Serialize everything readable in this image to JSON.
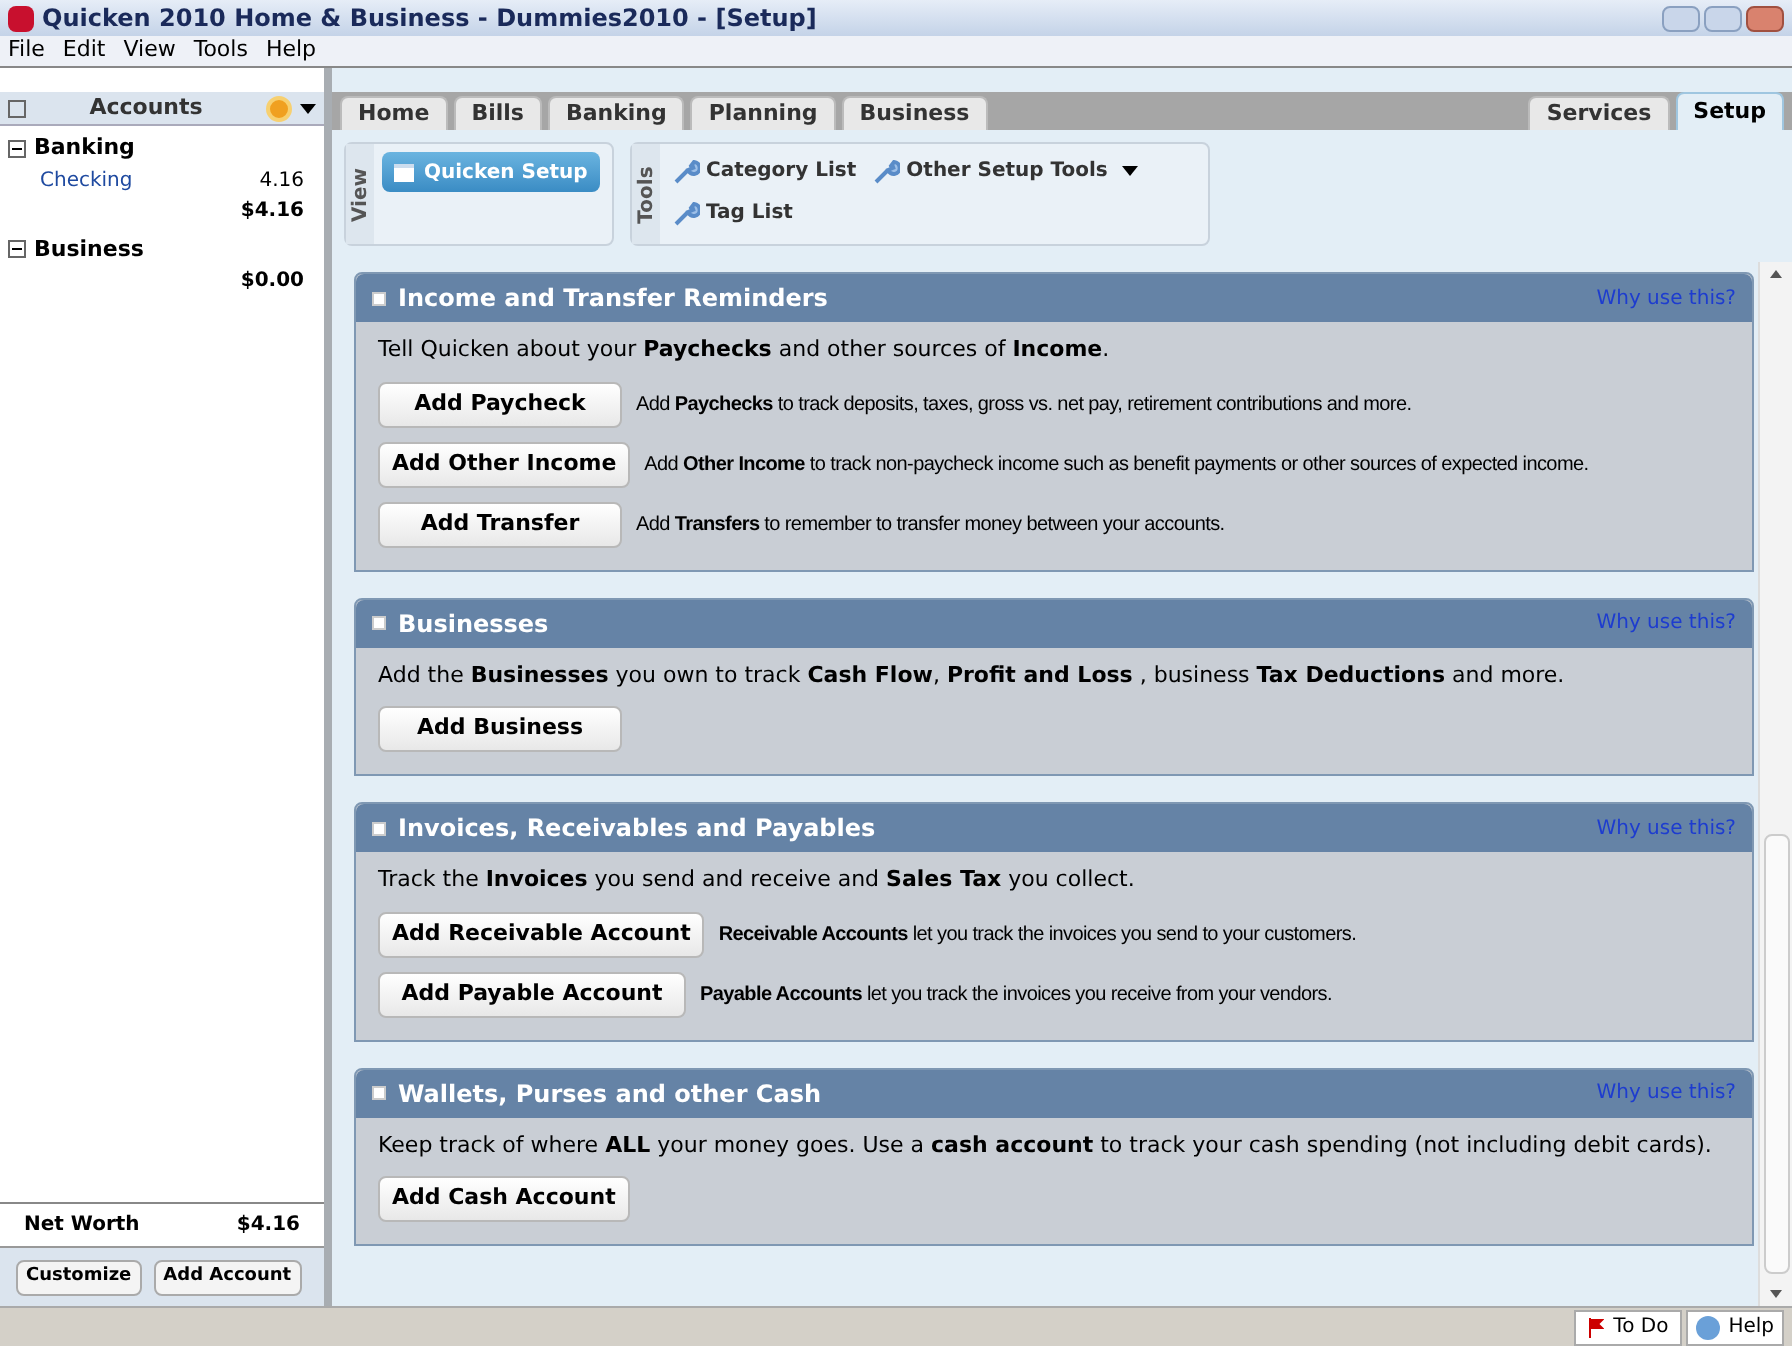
{
  "window": {
    "title": "Quicken 2010 Home & Business - Dummies2010 - [Setup]"
  },
  "menu": [
    "File",
    "Edit",
    "View",
    "Tools",
    "Help"
  ],
  "sidebar": {
    "header": "Accounts",
    "groups": [
      {
        "name": "Banking",
        "expanded": true,
        "items": [
          {
            "name": "Checking",
            "amount": "4.16"
          }
        ],
        "total": "$4.16"
      },
      {
        "name": "Business",
        "expanded": true,
        "total": "$0.00"
      }
    ],
    "net_worth_label": "Net Worth",
    "net_worth": "$4.16",
    "buttons": [
      "Customize",
      "Add Account"
    ]
  },
  "tabs_left": [
    {
      "label": "Home",
      "selected": false
    },
    {
      "label": "Bills",
      "selected": false
    },
    {
      "label": "Banking",
      "selected": false
    },
    {
      "label": "Planning",
      "selected": false
    },
    {
      "label": "Business",
      "selected": false
    }
  ],
  "tabs_right": [
    {
      "label": "Services",
      "selected": false
    },
    {
      "label": "Setup",
      "selected": true
    }
  ],
  "view_panel": {
    "label": "View",
    "button": "Quicken Setup"
  },
  "tools_panel": {
    "label": "Tools",
    "items": [
      {
        "label": "Category List",
        "dropdown": false
      },
      {
        "label": "Other Setup Tools",
        "dropdown": true
      },
      {
        "label": "Tag List",
        "dropdown": false
      }
    ]
  },
  "sections": [
    {
      "title": "Income and Transfer Reminders",
      "link": "Why use this?",
      "intro": "Tell Quicken about your **Paychecks** and other sources of **Income**.",
      "actions": [
        {
          "button": "Add Paycheck",
          "description": "Add **Paychecks** to track deposits, taxes, gross vs. net pay, retirement contributions and more."
        },
        {
          "button": "Add Other Income",
          "description": "Add **Other Income** to track non-paycheck income such as benefit payments or other sources of expected income."
        },
        {
          "button": "Add Transfer",
          "description": "Add **Transfers** to remember to transfer money between your accounts."
        }
      ]
    },
    {
      "title": "Businesses",
      "link": "Why use this?",
      "intro": "Add the **Businesses** you own to track **Cash Flow**, **Profit and Loss** , business **Tax Deductions** and more.",
      "actions": [
        {
          "button": "Add Business"
        }
      ]
    },
    {
      "title": "Invoices, Receivables and Payables",
      "link": "Why use this?",
      "intro": "Track the **Invoices** you send and receive and **Sales Tax** you collect.",
      "actions": [
        {
          "button": "Add Receivable Account",
          "description": "**Receivable Accounts** let you track the invoices you send to your customers."
        },
        {
          "button": "Add Payable Account",
          "description": "**Payable Accounts** let you track the invoices you receive from your vendors."
        }
      ]
    },
    {
      "title": "Wallets, Purses and other Cash",
      "link": "Why use this?",
      "intro": "Keep track of where **ALL** your money goes. Use a **cash account** to track your cash spending (not including debit cards).",
      "actions": [
        {
          "button": "Add Cash Account"
        }
      ]
    }
  ],
  "status_bar": {
    "todo": "To Do",
    "help": "Help"
  }
}
